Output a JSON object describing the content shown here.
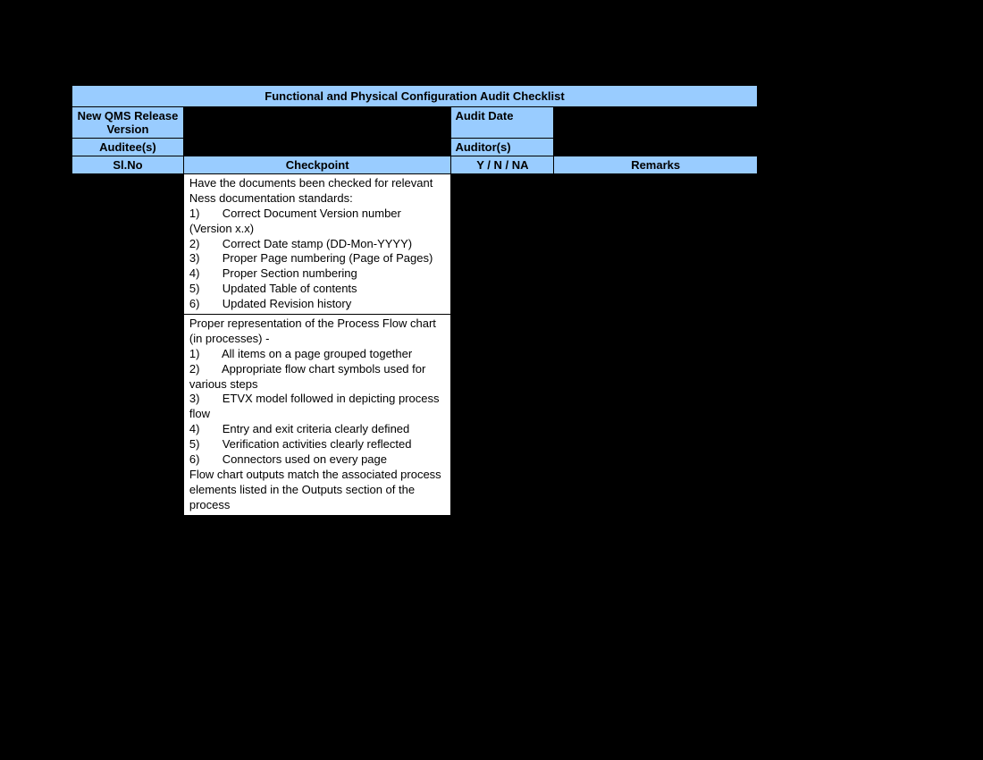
{
  "title": "Functional and Physical Configuration Audit Checklist",
  "meta": {
    "qms_label": "New QMS Release Version",
    "qms_value": "",
    "audit_date_label": "Audit Date",
    "audit_date_value": "",
    "auditee_label": "Auditee(s)",
    "auditee_value": "",
    "auditor_label": "Auditor(s)",
    "auditor_value": ""
  },
  "headers": {
    "slno": "Sl.No",
    "checkpoint": "Checkpoint",
    "yn": "Y / N / NA",
    "remarks": "Remarks"
  },
  "rows": [
    {
      "checkpoint": "Have the documents been checked for relevant Ness documentation standards:\n1)       Correct Document Version number (Version x.x)\n2)       Correct Date stamp (DD-Mon-YYYY)\n3)       Proper Page numbering (Page of Pages)\n4)       Proper Section numbering\n5)       Updated Table of contents\n6)       Updated Revision history"
    },
    {
      "checkpoint": "Proper representation of the Process Flow chart (in processes) -\n1)       All items on a page grouped together\n2)       Appropriate flow chart symbols used for various steps\n3)       ETVX model followed in depicting process flow\n4)       Entry and exit criteria clearly defined\n5)       Verification activities clearly reflected\n6)       Connectors used on every page\nFlow chart outputs match the associated process elements listed in the Outputs section of the process"
    }
  ]
}
